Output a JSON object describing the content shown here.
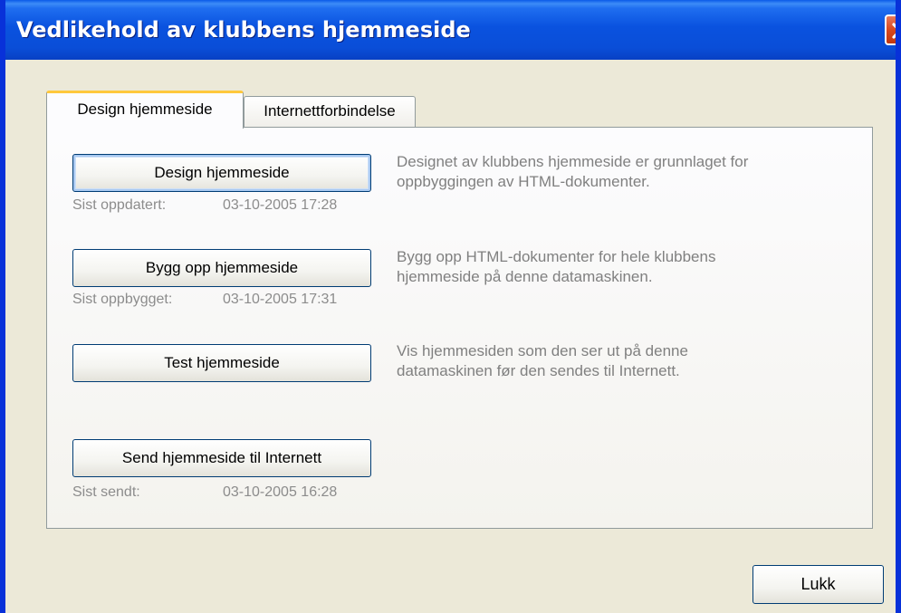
{
  "window": {
    "title": "Vedlikehold av klubbens hjemmeside",
    "close_icon": "close-icon"
  },
  "tabs": [
    {
      "label": "Design hjemmeside",
      "active": true
    },
    {
      "label": "Internettforbindelse",
      "active": false
    }
  ],
  "actions": [
    {
      "button_label": "Design hjemmeside",
      "status_label": "Sist oppdatert:",
      "status_value": "03-10-2005 17:28",
      "description_line1": "Designet av klubbens hjemmeside er grunnlaget for",
      "description_line2": "oppbyggingen av HTML-dokumenter."
    },
    {
      "button_label": "Bygg opp hjemmeside",
      "status_label": "Sist oppbygget:",
      "status_value": "03-10-2005 17:31",
      "description_line1": "Bygg opp HTML-dokumenter for hele klubbens",
      "description_line2": "hjemmeside på denne datamaskinen."
    },
    {
      "button_label": "Test hjemmeside",
      "description_line1": "Vis hjemmesiden som den ser ut på denne",
      "description_line2": "datamaskinen før den sendes til Internett."
    },
    {
      "button_label": "Send hjemmeside til Internett",
      "status_label": "Sist sendt:",
      "status_value": "03-10-2005 16:28"
    }
  ],
  "footer": {
    "close_label": "Lukk"
  },
  "colors": {
    "titlebar": "#0a52df",
    "tab_highlight": "#ffc83c",
    "button_border": "#003c74",
    "close_button": "#d8481e",
    "muted_text": "#8c8c8c"
  }
}
